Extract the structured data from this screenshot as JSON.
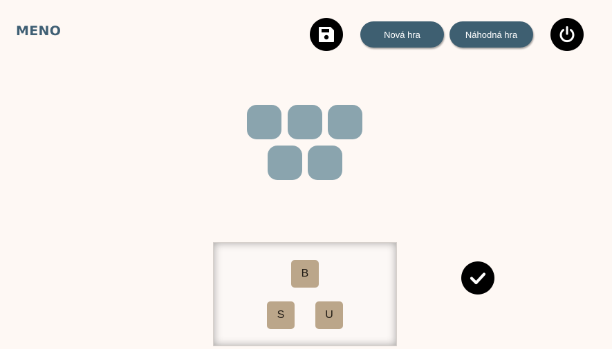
{
  "header": {
    "title": "MENO",
    "save_icon": "floppy-disk-icon",
    "new_game_label": "Nová hra",
    "random_game_label": "Náhodná hra",
    "power_icon": "power-icon"
  },
  "board": {
    "slot_count": 5,
    "slots": [
      "",
      "",
      "",
      "",
      ""
    ]
  },
  "tray": {
    "tiles": [
      "B",
      "S",
      "U"
    ]
  },
  "confirm": {
    "icon": "checkmark-icon"
  },
  "colors": {
    "background": "#fef8f4",
    "accent": "#3e5f71",
    "slot": "#8aa4ae",
    "tile": "#bba68a"
  }
}
